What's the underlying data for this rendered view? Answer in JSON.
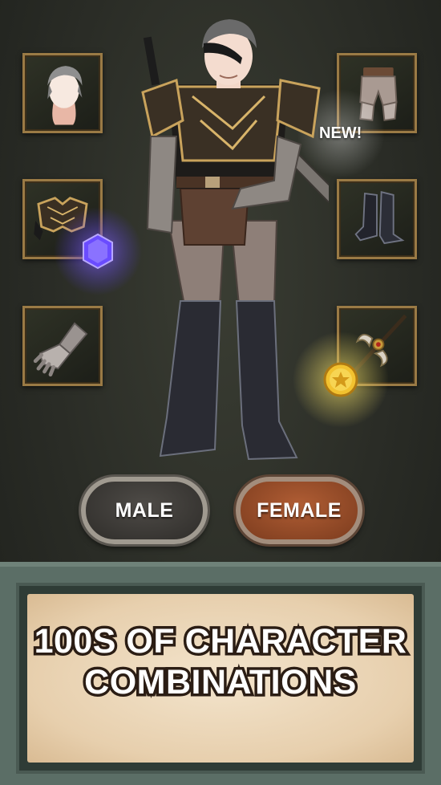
{
  "badge": {
    "new_label": "NEW!"
  },
  "slots": [
    {
      "name": "hair",
      "icon": "hair-head-icon"
    },
    {
      "name": "body-armor",
      "icon": "chest-armor-icon"
    },
    {
      "name": "gloves",
      "icon": "gauntlet-icon"
    },
    {
      "name": "pants",
      "icon": "pants-icon"
    },
    {
      "name": "boots",
      "icon": "boots-icon"
    },
    {
      "name": "weapon",
      "icon": "halberd-icon"
    }
  ],
  "buttons": {
    "male_label": "MALE",
    "female_label": "FEMALE"
  },
  "banner": {
    "line1": "100S OF CHARACTER",
    "line2": "COMBINATIONS"
  },
  "colors": {
    "female_button": "#9a4a27",
    "male_button": "#3e3b38",
    "gem": "#6a4cff",
    "coin": "#f2c230"
  }
}
